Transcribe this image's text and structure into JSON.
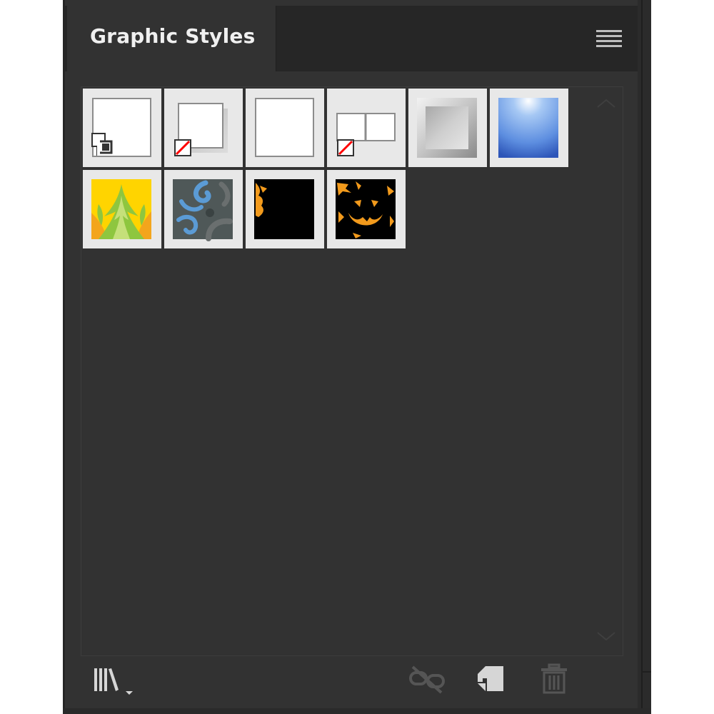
{
  "panel": {
    "title": "Graphic Styles",
    "menu_icon": "hamburger-menu-icon"
  },
  "colors": {
    "panel_bg": "#323232",
    "tab_bar_bg": "#262626",
    "tile_bg": "#e8e8e8",
    "title_text": "#f0f0f0",
    "icon_light": "#d6d6d6",
    "icon_disabled": "#555555"
  },
  "styles": [
    {
      "id": "default",
      "icon": "default-style-swatch-icon"
    },
    {
      "id": "drop-shadow",
      "icon": "drop-shadow-swatch-icon"
    },
    {
      "id": "plain-stroke",
      "icon": "plain-stroke-swatch-icon"
    },
    {
      "id": "double-box",
      "icon": "double-box-swatch-icon"
    },
    {
      "id": "silver-bevel",
      "icon": "silver-bevel-swatch-icon"
    },
    {
      "id": "blue-glow",
      "icon": "blue-glow-swatch-icon"
    },
    {
      "id": "green-flame-pattern",
      "icon": "green-flame-swatch-icon"
    },
    {
      "id": "blue-swirl-pattern",
      "icon": "blue-swirl-swatch-icon"
    },
    {
      "id": "black-orange-pattern",
      "icon": "black-orange-swatch-icon"
    },
    {
      "id": "jack-o-lantern-pattern",
      "icon": "jack-o-lantern-swatch-icon"
    }
  ],
  "footer": {
    "library_button": {
      "icon": "graphic-styles-library-icon",
      "enabled": true
    },
    "break_link_button": {
      "icon": "break-link-icon",
      "enabled": false
    },
    "new_style_button": {
      "icon": "new-graphic-style-icon",
      "enabled": true
    },
    "delete_button": {
      "icon": "trash-icon",
      "enabled": false
    }
  }
}
